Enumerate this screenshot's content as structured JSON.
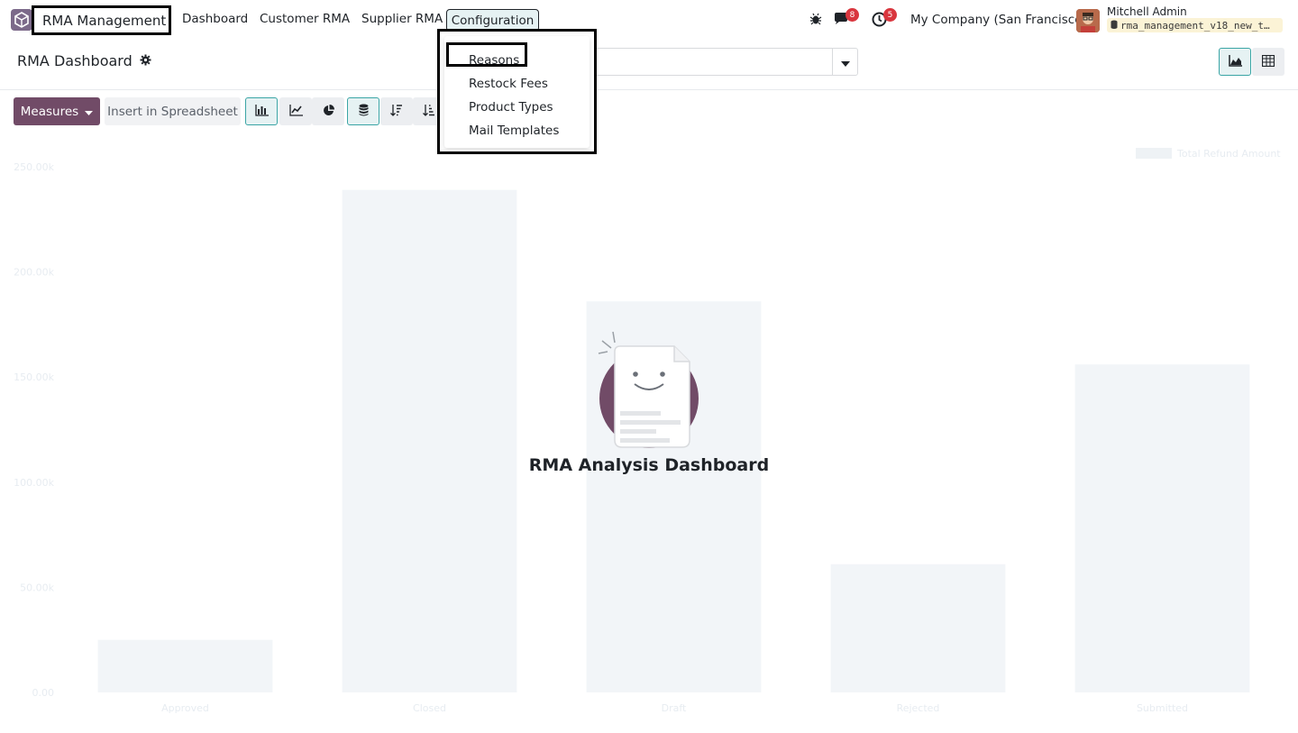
{
  "navbar": {
    "app_name": "RMA Management",
    "menu": [
      "Dashboard",
      "Customer RMA",
      "Supplier RMA"
    ],
    "config_label": "Configuration",
    "messages_count": "8",
    "activities_count": "5",
    "company": "My Company (San Francisco)",
    "user_name": "Mitchell Admin",
    "db_name": "rma_management_v18_new_t…"
  },
  "control": {
    "breadcrumb": "RMA Dashboard"
  },
  "toolbar": {
    "measures_label": "Measures",
    "spreadsheet_label": "Insert in Spreadsheet"
  },
  "dropdown": {
    "items": [
      "Reasons",
      "Restock Fees",
      "Product Types",
      "Mail Templates"
    ]
  },
  "helper": {
    "title": "RMA Analysis Dashboard"
  },
  "colors": {
    "brand": "#714b67",
    "accent": "#3aa5a5",
    "badge": "#d9363e"
  },
  "chart_data": {
    "type": "bar",
    "categories": [
      "Approved",
      "Closed",
      "Draft",
      "Rejected",
      "Submitted"
    ],
    "series": [
      {
        "name": "Total Refund Amount",
        "values": [
          25000,
          239000,
          186000,
          61000,
          156000
        ]
      }
    ],
    "y_ticks": [
      "0.00",
      "50.00k",
      "100.00k",
      "150.00k",
      "200.00k",
      "250.00k"
    ],
    "ylim": [
      0,
      250000
    ],
    "legend": "top-right"
  }
}
